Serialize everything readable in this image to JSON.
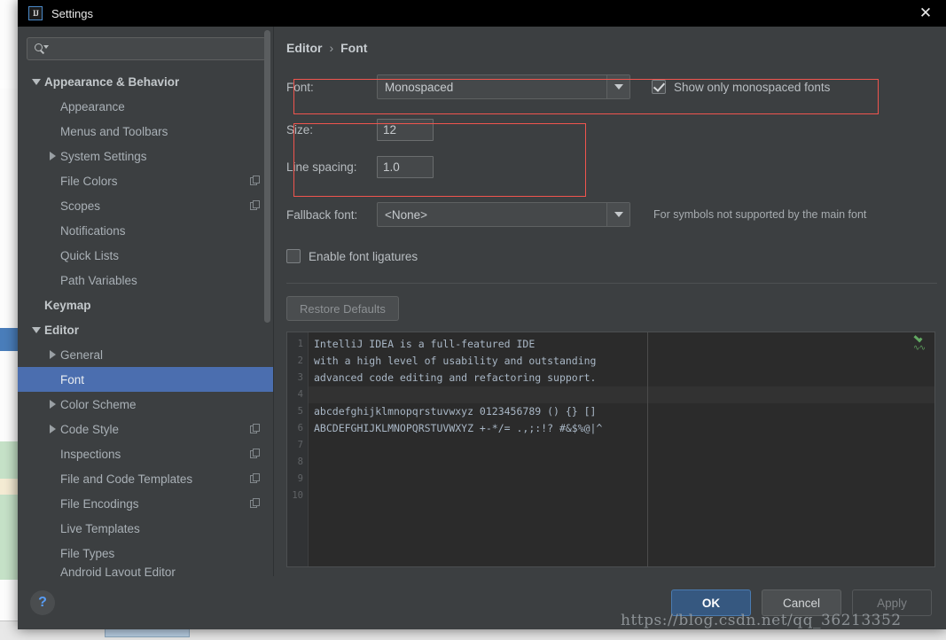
{
  "window": {
    "title": "Settings",
    "logo_text": "IJ",
    "close_label": "✕"
  },
  "sidebar": {
    "search": {
      "value": "",
      "placeholder": ""
    },
    "items": [
      {
        "label": "Appearance & Behavior",
        "level": 0,
        "twisty": "down",
        "bold": true,
        "selected": false,
        "copy": false
      },
      {
        "label": "Appearance",
        "level": 1,
        "twisty": "none",
        "bold": false,
        "selected": false,
        "copy": false
      },
      {
        "label": "Menus and Toolbars",
        "level": 1,
        "twisty": "none",
        "bold": false,
        "selected": false,
        "copy": false
      },
      {
        "label": "System Settings",
        "level": 1,
        "twisty": "right",
        "bold": false,
        "selected": false,
        "copy": false
      },
      {
        "label": "File Colors",
        "level": 1,
        "twisty": "none",
        "bold": false,
        "selected": false,
        "copy": true
      },
      {
        "label": "Scopes",
        "level": 1,
        "twisty": "none",
        "bold": false,
        "selected": false,
        "copy": true
      },
      {
        "label": "Notifications",
        "level": 1,
        "twisty": "none",
        "bold": false,
        "selected": false,
        "copy": false
      },
      {
        "label": "Quick Lists",
        "level": 1,
        "twisty": "none",
        "bold": false,
        "selected": false,
        "copy": false
      },
      {
        "label": "Path Variables",
        "level": 1,
        "twisty": "none",
        "bold": false,
        "selected": false,
        "copy": false
      },
      {
        "label": "Keymap",
        "level": 0,
        "twisty": "none",
        "bold": true,
        "selected": false,
        "copy": false
      },
      {
        "label": "Editor",
        "level": 0,
        "twisty": "down",
        "bold": true,
        "selected": false,
        "copy": false
      },
      {
        "label": "General",
        "level": 1,
        "twisty": "right",
        "bold": false,
        "selected": false,
        "copy": false
      },
      {
        "label": "Font",
        "level": 1,
        "twisty": "none",
        "bold": false,
        "selected": true,
        "copy": false
      },
      {
        "label": "Color Scheme",
        "level": 1,
        "twisty": "right",
        "bold": false,
        "selected": false,
        "copy": false
      },
      {
        "label": "Code Style",
        "level": 1,
        "twisty": "right",
        "bold": false,
        "selected": false,
        "copy": true
      },
      {
        "label": "Inspections",
        "level": 1,
        "twisty": "none",
        "bold": false,
        "selected": false,
        "copy": true
      },
      {
        "label": "File and Code Templates",
        "level": 1,
        "twisty": "none",
        "bold": false,
        "selected": false,
        "copy": true
      },
      {
        "label": "File Encodings",
        "level": 1,
        "twisty": "none",
        "bold": false,
        "selected": false,
        "copy": true
      },
      {
        "label": "Live Templates",
        "level": 1,
        "twisty": "none",
        "bold": false,
        "selected": false,
        "copy": false
      },
      {
        "label": "File Types",
        "level": 1,
        "twisty": "none",
        "bold": false,
        "selected": false,
        "copy": false
      },
      {
        "label": "Android Layout Editor",
        "level": 1,
        "twisty": "none",
        "bold": false,
        "selected": false,
        "copy": false
      }
    ]
  },
  "main": {
    "breadcrumb": {
      "root": "Editor",
      "separator": "›",
      "leaf": "Font"
    },
    "font_row": {
      "label": "Font:",
      "value": "Monospaced",
      "monospaced_checkbox": {
        "label": "Show only monospaced fonts",
        "checked": true
      }
    },
    "size_row": {
      "label": "Size:",
      "value": "12"
    },
    "line_spacing_row": {
      "label": "Line spacing:",
      "value": "1.0"
    },
    "fallback_row": {
      "label": "Fallback font:",
      "value": "<None>",
      "hint": "For symbols not supported by the main font"
    },
    "ligatures_checkbox": {
      "label": "Enable font ligatures",
      "checked": false
    },
    "restore_defaults_button": {
      "label": "Restore Defaults",
      "enabled": false
    }
  },
  "preview": {
    "line_numbers": [
      "1",
      "2",
      "3",
      "4",
      "5",
      "6",
      "7",
      "8",
      "9",
      "10"
    ],
    "lines": [
      "IntelliJ IDEA is a full-featured IDE",
      "with a high level of usability and outstanding",
      "advanced code editing and refactoring support.",
      "",
      "abcdefghijklmnopqrstuvwxyz 0123456789 () {} []",
      "ABCDEFGHIJKLMNOPQRSTUVWXYZ +-*/= .,;:!? #&$%@|^",
      "",
      "",
      "",
      ""
    ],
    "caret_line_index": 3,
    "inspection_status": "ok-checkmark"
  },
  "footer": {
    "help_label": "?",
    "ok_label": "OK",
    "cancel_label": "Cancel",
    "apply_label": "Apply",
    "apply_enabled": false
  },
  "watermark": {
    "text": "https://blog.csdn.net/qq_36213352"
  },
  "colors": {
    "accent_blue": "#4b6eaf",
    "primary_button": "#365880",
    "annotation_red": "#f0554e",
    "panel_bg": "#3c3f41",
    "editor_bg": "#2b2b2b",
    "inspection_green": "#62a862"
  }
}
